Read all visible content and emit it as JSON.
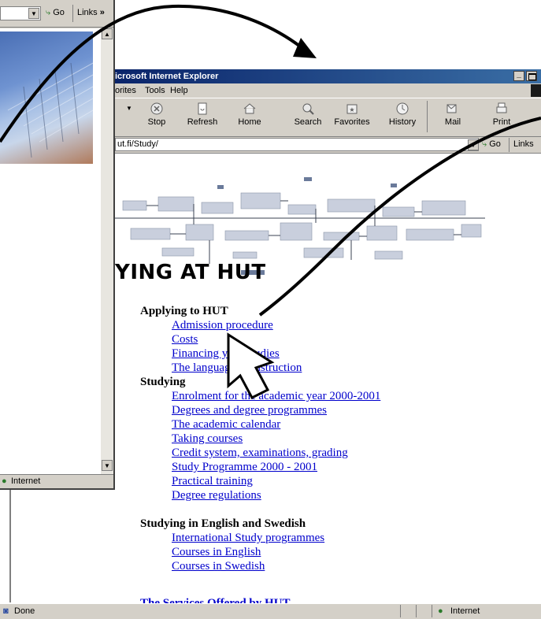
{
  "back_window": {
    "go_label": "Go",
    "links_label": "Links",
    "chevron": "»",
    "status_zone": "Internet"
  },
  "front_window": {
    "title": "icrosoft Internet Explorer",
    "menu": [
      "orites",
      "Tools",
      "Help"
    ],
    "toolbar": [
      {
        "label": "Stop",
        "icon": "stop-icon"
      },
      {
        "label": "Refresh",
        "icon": "refresh-icon"
      },
      {
        "label": "Home",
        "icon": "home-icon"
      },
      {
        "label": "Search",
        "icon": "search-icon"
      },
      {
        "label": "Favorites",
        "icon": "favorites-icon"
      },
      {
        "label": "History",
        "icon": "history-icon"
      },
      {
        "label": "Mail",
        "icon": "mail-icon"
      },
      {
        "label": "Print",
        "icon": "print-icon"
      }
    ],
    "address": "ut.fi/Study/",
    "go_label": "Go",
    "links_label": "Links"
  },
  "page": {
    "heading": "YING AT HUT",
    "sections": [
      {
        "title": "Applying to HUT",
        "links": [
          "Admission procedure",
          "Costs",
          "Financing your studies",
          "The language of instruction"
        ]
      },
      {
        "title": "Studying",
        "links": [
          "Enrolment for the academic year 2000-2001",
          "Degrees and degree programmes",
          "The academic calendar",
          "Taking courses",
          "Credit system, examinations, grading",
          "Study Programme 2000 - 2001",
          "Practical training",
          "Degree regulations"
        ]
      },
      {
        "title": "Studying in English and Swedish",
        "links": [
          "International Study programmes",
          "Courses in English",
          "Courses in Swedish"
        ]
      }
    ],
    "cut_off_text": "The Services Offered by HUT"
  },
  "status": {
    "left": "Done",
    "zone": "Internet"
  },
  "colors": {
    "title_bar": "#0a246a",
    "link": "#0000cc",
    "chrome": "#d4d0c8"
  }
}
